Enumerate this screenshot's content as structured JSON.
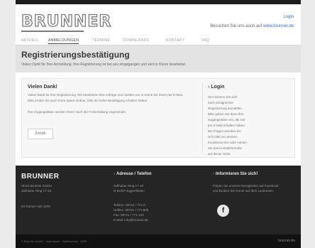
{
  "header": {
    "logo": "BRUNNER",
    "login_link": "Login",
    "visit_text": "Besuchen Sie uns auch auf",
    "visit_url": "www.brunner.de"
  },
  "nav": {
    "items": [
      {
        "label": "AKTUELL"
      },
      {
        "label": "ANMELDUNGEN"
      },
      {
        "label": "TERMINE"
      },
      {
        "label": "DOWNLOADS"
      },
      {
        "label": "KONTAKT"
      },
      {
        "label": "FAQ"
      }
    ]
  },
  "main": {
    "title": "Registrierungsbestätigung",
    "subtitle": "Vielen Dank für Ihre Anmeldung. Ihre Registrierung ist bei uns eingegangen und wird in Kürze bearbeitet.",
    "thanks_title": "Vielen Dank!",
    "thanks_lines": [
      "Vielen Dank für Ihre Registrierung. Wir bearbeiten Ihre Anfrage und melden uns in Kürze bei Ihnen per E-Mail.",
      "Bitte prüfen Sie auch Ihren Spam-Ordner, falls Sie keine Bestätigung erhalten haben.",
      "Ihre Zugangsdaten werden Ihnen nach der Freischaltung zugesendet."
    ],
    "back_button": "Zurück"
  },
  "login_box": {
    "title": "Login",
    "lines": [
      "Hier können Sie sich",
      "nach erfolgreicher",
      "Registrierung anmelden.",
      "Bitte geben Sie dazu Ihre",
      "Zugangsdaten ein, die Sie",
      "per E-Mail erhalten haben.",
      "Bei Fragen wenden Sie",
      "sich bitte an unseren",
      "Kundenservice oder nutzen",
      "Sie das Kontaktformular",
      "auf dieser Seite."
    ]
  },
  "footer": {
    "brand": "BRUNNER",
    "brand_lines": [
      "Ulrich Brunner GmbH",
      "Zellhuber Ring 17-18"
    ],
    "brand_extra": "Ihr Partner seit 1978",
    "col2_title": "Adresse / Telefon",
    "address": [
      "Zellhuber Ring 17-18",
      "D-84307 Eggenfelden"
    ],
    "contacts": [
      "Telefon: 08721 / 771-0",
      "Hotline: 08721 / 771-500",
      "Fax: 08721 / 771-100",
      "E-Mail: info@brunner.de"
    ],
    "col3_title": "Informieren Sie sich!",
    "col3_lines": [
      "Folgen Sie unseren Neuigkeiten auf Facebook",
      "und bleiben Sie immer auf dem Laufenden."
    ],
    "fb_icon": "f"
  },
  "bottom": {
    "left_text": "© Brunner GmbH · Impressum · Datenschutz · AGB",
    "right_text": "brunner.de"
  }
}
